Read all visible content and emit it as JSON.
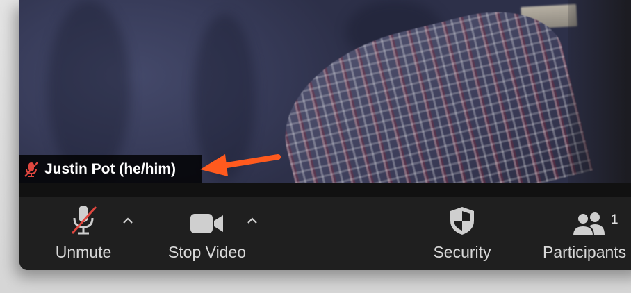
{
  "name_tag": {
    "name": "Justin Pot (he/him)",
    "mic_state_icon": "muted-mic-icon"
  },
  "toolbar": {
    "unmute_label": "Unmute",
    "stop_video_label": "Stop Video",
    "security_label": "Security",
    "participants_label": "Participants",
    "participants_count": "1"
  },
  "colors": {
    "muted_red": "#e0473f",
    "arrow_orange": "#ff5a1e",
    "toolbar_bg": "#1f1f1f",
    "icon_gray": "#cfcfcf"
  }
}
